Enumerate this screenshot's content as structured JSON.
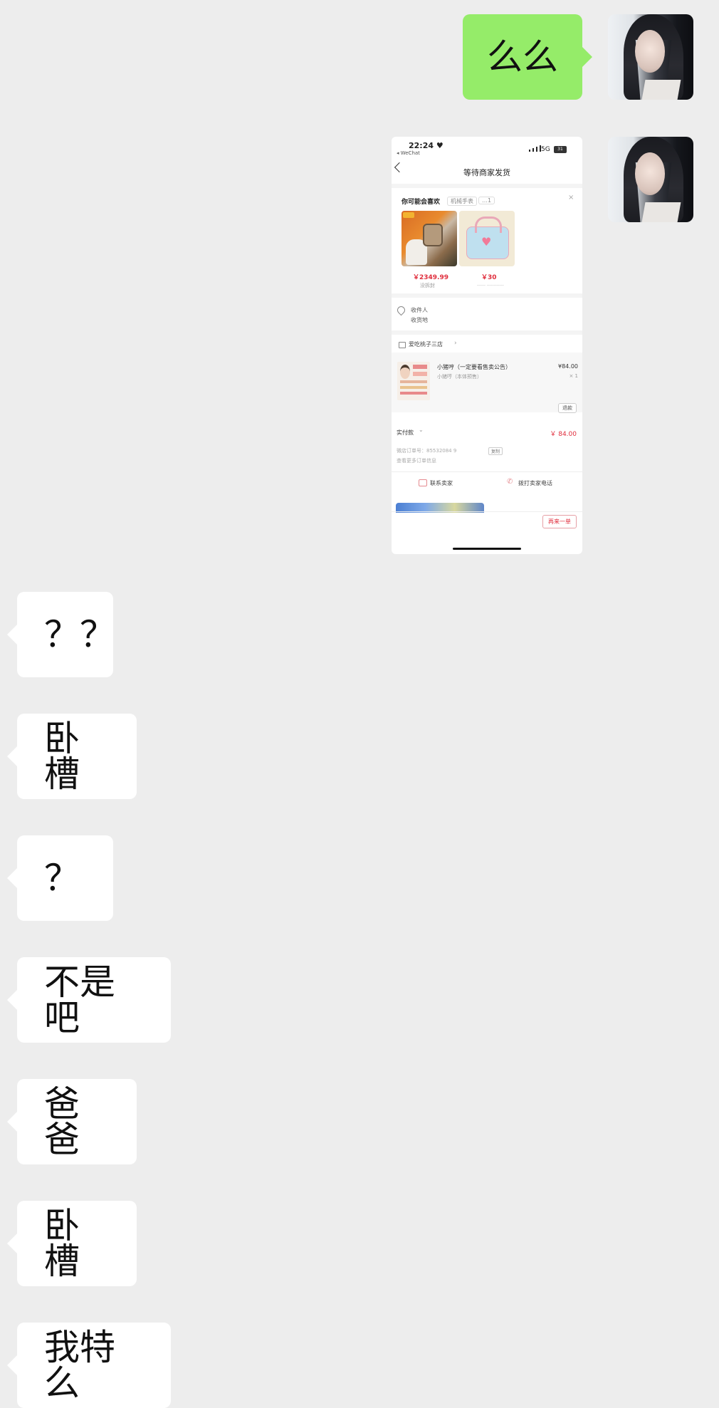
{
  "messages": {
    "out_1": "么么",
    "in": [
      "？？",
      "卧槽",
      "？",
      "不是吧",
      "爸爸",
      "卧槽",
      "我特么"
    ]
  },
  "screenshot": {
    "status_time": "22:24 ♥",
    "back_app": "◂ WeChat",
    "network": "5G",
    "battery": "31",
    "title": "等待商家发货",
    "recommend_title": "你可能会喜欢",
    "recommend_tags": [
      "机械手表",
      "…1"
    ],
    "rec_items": [
      {
        "price": "￥2349.99",
        "sub": "没拆封"
      },
      {
        "price": "￥30",
        "sub": "…… …………"
      }
    ],
    "address_label": "收件人",
    "address_value": "收货地",
    "shop_name": "爱吃桃子三店",
    "product_name": "小猪哼（一定要看售卖公告）",
    "product_spec": "小猪哼（本体预售）",
    "product_price": "¥84.00",
    "product_qty": "× 1",
    "refund_btn": "退款",
    "paid_label": "实付款",
    "paid_value": "￥ 84.00",
    "order_no": "微店订单号：85532084   9",
    "copy_btn": "复制",
    "more_info": "查看更多订单信息",
    "contact_seller": "联系卖家",
    "call_seller": "拨打卖家电话",
    "rebuy_btn": "再来一单"
  },
  "colors": {
    "background": "#ededed",
    "outgoing_bubble": "#95ec69",
    "incoming_bubble": "#ffffff",
    "price_red": "#e02e3d"
  }
}
